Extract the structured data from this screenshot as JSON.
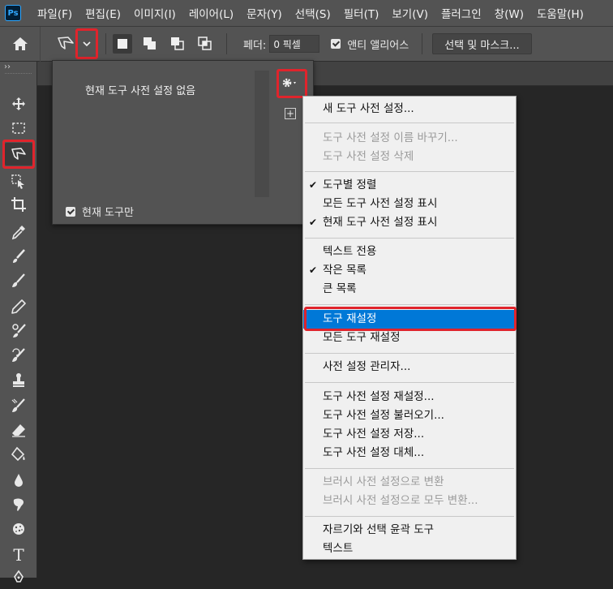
{
  "menubar": {
    "logo": "Ps",
    "items": [
      "파일(F)",
      "편집(E)",
      "이미지(I)",
      "레이어(L)",
      "문자(Y)",
      "선택(S)",
      "필터(T)",
      "보기(V)",
      "플러그인",
      "창(W)",
      "도움말(H)"
    ]
  },
  "options": {
    "feather_label": "페더:",
    "feather_value": "0 픽셀",
    "antialias_label": "앤티 앨리어스",
    "antialias_checked": true,
    "select_mask_label": "선택 및 마스크..."
  },
  "toolbar": {
    "collapse_label": "››",
    "tools": [
      "move-tool",
      "marquee-tool",
      "polygonal-lasso-tool",
      "object-selection-tool",
      "crop-tool",
      "eyedropper-tool",
      "healing-brush-tool",
      "brush-tool",
      "pencil-tool",
      "clone-stamp-tool",
      "history-brush-tool",
      "eraser-tool",
      "paint-bucket-tool",
      "blur-tool",
      "smudge-tool",
      "sponge-tool",
      "type-tool",
      "pen-tool"
    ],
    "selected_tool": "polygonal-lasso-tool",
    "type_tool_glyph": "T"
  },
  "preset_panel": {
    "empty_text": "현재 도구 사전 설정 없음",
    "current_only_label": "현재 도구만",
    "current_only_checked": true,
    "new_preset_glyph": "+"
  },
  "context_menu": {
    "items": [
      {
        "label": "새 도구 사전 설정...",
        "enabled": true,
        "checked": false
      },
      {
        "label": "도구 사전 설정 이름 바꾸기...",
        "enabled": false,
        "checked": false
      },
      {
        "label": "도구 사전 설정 삭제",
        "enabled": false,
        "checked": false
      },
      {
        "label": "도구별 정렬",
        "enabled": true,
        "checked": true
      },
      {
        "label": "모든 도구 사전 설정 표시",
        "enabled": true,
        "checked": false
      },
      {
        "label": "현재 도구 사전 설정 표시",
        "enabled": true,
        "checked": true
      },
      {
        "label": "텍스트 전용",
        "enabled": true,
        "checked": false
      },
      {
        "label": "작은 목록",
        "enabled": true,
        "checked": true
      },
      {
        "label": "큰 목록",
        "enabled": true,
        "checked": false
      },
      {
        "label": "도구 재설정",
        "enabled": true,
        "checked": false,
        "highlighted": true
      },
      {
        "label": "모든 도구 재설정",
        "enabled": true,
        "checked": false
      },
      {
        "label": "사전 설정 관리자...",
        "enabled": true,
        "checked": false
      },
      {
        "label": "도구 사전 설정 재설정...",
        "enabled": true,
        "checked": false
      },
      {
        "label": "도구 사전 설정 불러오기...",
        "enabled": true,
        "checked": false
      },
      {
        "label": "도구 사전 설정 저장...",
        "enabled": true,
        "checked": false
      },
      {
        "label": "도구 사전 설정 대체...",
        "enabled": true,
        "checked": false
      },
      {
        "label": "브러시 사전 설정으로 변환",
        "enabled": false,
        "checked": false
      },
      {
        "label": "브러시 사전 설정으로 모두 변환...",
        "enabled": false,
        "checked": false
      },
      {
        "label": "자르기와 선택 윤곽 도구",
        "enabled": true,
        "checked": false
      },
      {
        "label": "텍스트",
        "enabled": true,
        "checked": false
      }
    ],
    "check_glyph": "✔"
  },
  "colors": {
    "app_bg": "#262626",
    "panel_bg": "#535353",
    "highlight": "#0078d7",
    "annotation_red": "#e0242c"
  }
}
